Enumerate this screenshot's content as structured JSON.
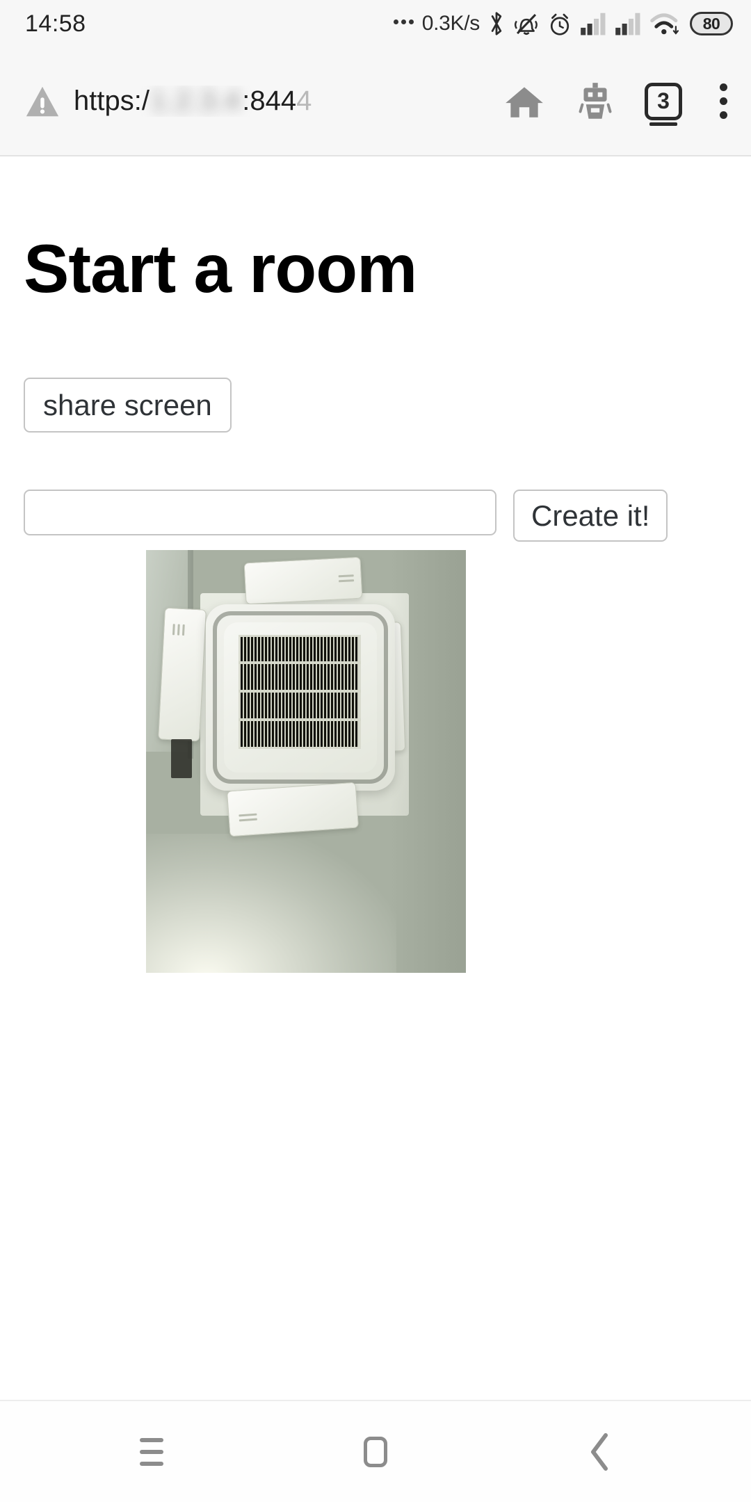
{
  "status_bar": {
    "clock": "14:58",
    "network_speed": "0.3K/s",
    "battery_level": "80",
    "icons": [
      "ellipsis-icon",
      "bluetooth-icon",
      "bell-muted-icon",
      "alarm-clock-icon",
      "signal-bars-icon",
      "signal-bars-icon",
      "wifi-icon",
      "battery-icon"
    ]
  },
  "browser": {
    "security_icon": "warning-triangle-icon",
    "url_scheme": "https:/",
    "url_host_redacted": "1.2.3.4",
    "url_port": ":844",
    "url_fade": "4",
    "home_icon": "home-icon",
    "assistant_icon": "robot-icon",
    "tab_count": "3",
    "menu_icon": "kebab-menu-icon"
  },
  "page": {
    "title": "Start a room",
    "share_screen_label": "share screen",
    "room_input_value": "",
    "room_input_placeholder": "",
    "create_label": "Create it!",
    "photo_alt": "ceiling-cassette-air-conditioner-photo"
  },
  "navigation_bar": {
    "recents_label": "recents-button",
    "home_label": "home-button",
    "back_label": "back-button"
  },
  "colors": {
    "chrome_bg": "#f7f7f7",
    "page_bg": "#ffffff",
    "text": "#1e1e1e",
    "button_border": "#c4c4c4",
    "button_text": "#2f3337",
    "nav_icon": "#8c8c8c"
  }
}
